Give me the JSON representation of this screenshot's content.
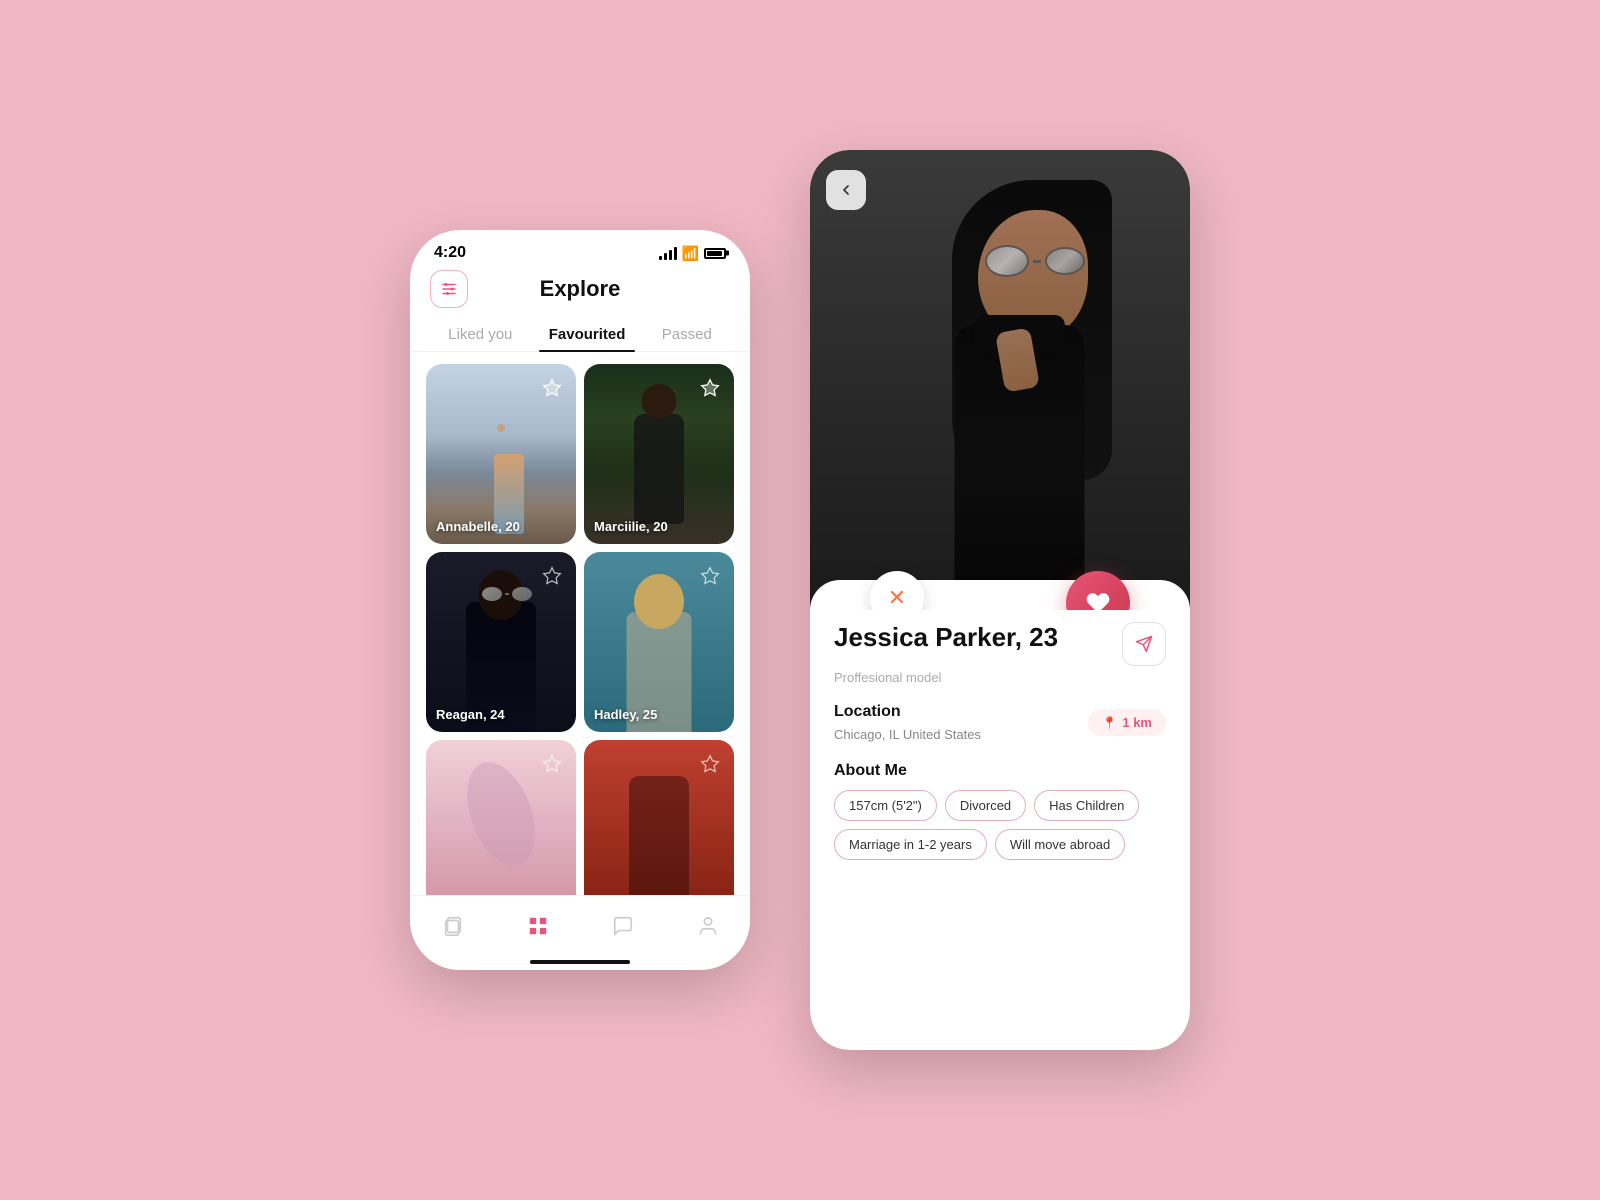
{
  "background_color": "#f0b8c4",
  "phone1": {
    "status": {
      "time": "4:20"
    },
    "header": {
      "title": "Explore",
      "filter_label": "filter"
    },
    "tabs": [
      {
        "id": "liked",
        "label": "Liked you",
        "active": false
      },
      {
        "id": "favourited",
        "label": "Favourited",
        "active": true
      },
      {
        "id": "passed",
        "label": "Passed",
        "active": false
      }
    ],
    "cards": [
      {
        "id": "annabelle",
        "name": "Annabelle, 20",
        "scene": "annabelle"
      },
      {
        "id": "marciilie",
        "name": "Marciilie, 20",
        "scene": "marciilie"
      },
      {
        "id": "reagan",
        "name": "Reagan, 24",
        "scene": "reagan"
      },
      {
        "id": "hadley",
        "name": "Hadley, 25",
        "scene": "hadley"
      },
      {
        "id": "extra1",
        "name": "",
        "scene": "extra1"
      },
      {
        "id": "extra2",
        "name": "",
        "scene": "extra2"
      }
    ],
    "nav": [
      {
        "id": "cards",
        "icon": "🂠",
        "active": false
      },
      {
        "id": "grid",
        "icon": "⊞",
        "active": true
      },
      {
        "id": "chat",
        "icon": "💬",
        "active": false
      },
      {
        "id": "profile",
        "icon": "👤",
        "active": false
      }
    ]
  },
  "phone2": {
    "profile": {
      "name": "Jessica Parker, 23",
      "subtitle": "Proffesional model",
      "location_label": "Location",
      "location_text": "Chicago, IL United States",
      "distance": "1 km",
      "about_label": "About Me",
      "tags": [
        "157cm (5'2\")",
        "Divorced",
        "Has Children",
        "Marriage in 1-2 years",
        "Will move abroad"
      ]
    },
    "actions": {
      "back": "‹",
      "dislike": "✕",
      "like": "♥",
      "share": "share"
    }
  }
}
